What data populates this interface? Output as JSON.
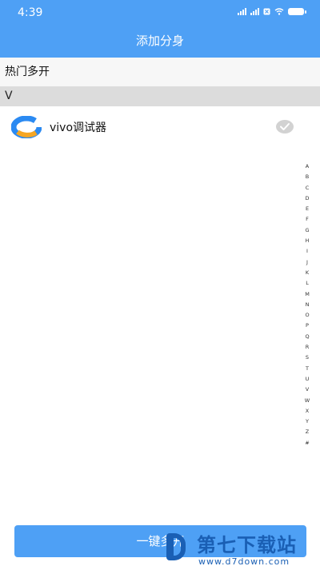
{
  "status_bar": {
    "time": "4:39"
  },
  "header": {
    "title": "添加分身"
  },
  "hot_section": {
    "label": "热门多开"
  },
  "sections": [
    {
      "letter": "V",
      "apps": [
        {
          "name": "vivo调试器",
          "selected": false
        }
      ]
    }
  ],
  "index_bar": {
    "letters": [
      "A",
      "B",
      "C",
      "D",
      "E",
      "F",
      "G",
      "H",
      "I",
      "J",
      "K",
      "L",
      "M",
      "N",
      "O",
      "P",
      "Q",
      "R",
      "S",
      "T",
      "U",
      "V",
      "W",
      "X",
      "Y",
      "Z",
      "#"
    ]
  },
  "footer": {
    "button_label": "一键多开"
  },
  "watermark": {
    "title": "第七下载站",
    "url": "www.d7down.com"
  }
}
